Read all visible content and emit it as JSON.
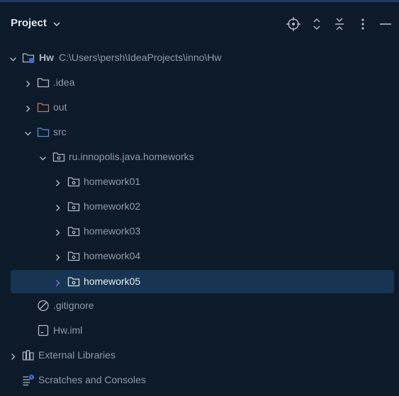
{
  "header": {
    "title": "Project",
    "icons": [
      "chevron-down-icon",
      "locate-icon",
      "expand-icon",
      "collapse-icon",
      "more-icon",
      "minimize-icon"
    ]
  },
  "tree": {
    "root": {
      "label": "Hw",
      "path": "C:\\Users\\persh\\IdeaProjects\\inno\\Hw"
    },
    "idea": {
      "label": ".idea"
    },
    "out": {
      "label": "out"
    },
    "src": {
      "label": "src"
    },
    "pkg": {
      "label": "ru.innopolis.java.homeworks"
    },
    "hw": [
      {
        "label": "homework01"
      },
      {
        "label": "homework02"
      },
      {
        "label": "homework03"
      },
      {
        "label": "homework04"
      },
      {
        "label": "homework05"
      }
    ],
    "gitignore": {
      "label": ".gitignore"
    },
    "iml": {
      "label": "Hw.iml"
    },
    "extlib": {
      "label": "External Libraries"
    },
    "scratches": {
      "label": "Scratches and Consoles"
    }
  },
  "colors": {
    "background": "#0d1a2a",
    "selection": "#173552",
    "folder_out": "#b87a52",
    "folder_src": "#5b8fd6",
    "selected_arrow": "#8f6fd9"
  }
}
